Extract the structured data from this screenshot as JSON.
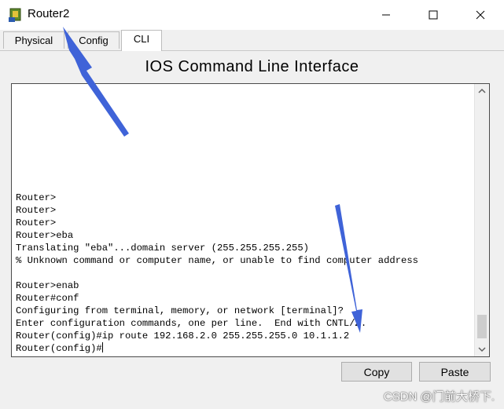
{
  "window": {
    "title": "Router2",
    "controls": {
      "minimize": "minimize",
      "maximize": "maximize",
      "close": "close"
    }
  },
  "tabs": [
    {
      "label": "Physical",
      "active": false
    },
    {
      "label": "Config",
      "active": false
    },
    {
      "label": "CLI",
      "active": true
    }
  ],
  "cli": {
    "heading": "IOS Command Line Interface",
    "lines": [
      "Router>",
      "Router>",
      "Router>",
      "Router>eba",
      "Translating \"eba\"...domain server (255.255.255.255)",
      "% Unknown command or computer name, or unable to find computer address",
      "",
      "Router>enab",
      "Router#conf",
      "Configuring from terminal, memory, or network [terminal]?",
      "Enter configuration commands, one per line.  End with CNTL/Z.",
      "Router(config)#ip route 192.168.2.0 255.255.255.0 10.1.1.2",
      "Router(config)#"
    ]
  },
  "buttons": {
    "copy": "Copy",
    "paste": "Paste"
  },
  "watermark": "CSDN @门前大桥下.",
  "colors": {
    "annotation_arrow": "#3f63d8",
    "terminal_bg": "#ffffff",
    "window_bg": "#f0f0f0"
  }
}
